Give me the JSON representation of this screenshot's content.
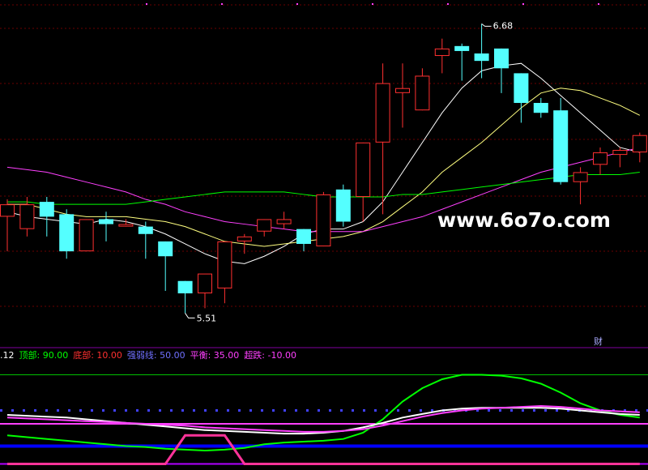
{
  "watermark": "www.6o7o.com",
  "finance_badge": "财",
  "indicator_header": [
    {
      "text": ".12",
      "color": "#ffffff"
    },
    {
      "text": "顶部: 90.00",
      "color": "#00ff00"
    },
    {
      "text": "底部: 10.00",
      "color": "#ff3030"
    },
    {
      "text": "强弱线: 50.00",
      "color": "#7070ff"
    },
    {
      "text": "平衡: 35.00",
      "color": "#ff40ff"
    },
    {
      "text": "超跌: -10.00",
      "color": "#ff40ff"
    }
  ],
  "chart_data": [
    {
      "type": "candlestick",
      "ylim": [
        5.4,
        6.75
      ],
      "price_labels": {
        "high": "6.68",
        "low": "5.51"
      },
      "candles": [
        {
          "o": 5.9,
          "h": 5.97,
          "l": 5.76,
          "c": 5.95
        },
        {
          "o": 5.85,
          "h": 5.98,
          "l": 5.82,
          "c": 5.95
        },
        {
          "o": 5.96,
          "h": 5.98,
          "l": 5.82,
          "c": 5.9
        },
        {
          "o": 5.91,
          "h": 5.93,
          "l": 5.73,
          "c": 5.76
        },
        {
          "o": 5.76,
          "h": 5.89,
          "l": 5.76,
          "c": 5.89
        },
        {
          "o": 5.89,
          "h": 5.92,
          "l": 5.8,
          "c": 5.87
        },
        {
          "o": 5.86,
          "h": 5.89,
          "l": 5.86,
          "c": 5.87
        },
        {
          "o": 5.86,
          "h": 5.88,
          "l": 5.73,
          "c": 5.83
        },
        {
          "o": 5.8,
          "h": 5.8,
          "l": 5.6,
          "c": 5.74
        },
        {
          "o": 5.64,
          "h": 5.64,
          "l": 5.51,
          "c": 5.59
        },
        {
          "o": 5.59,
          "h": 5.66,
          "l": 5.53,
          "c": 5.67
        },
        {
          "o": 5.61,
          "h": 5.8,
          "l": 5.55,
          "c": 5.8
        },
        {
          "o": 5.8,
          "h": 5.83,
          "l": 5.75,
          "c": 5.82
        },
        {
          "o": 5.84,
          "h": 5.89,
          "l": 5.82,
          "c": 5.89
        },
        {
          "o": 5.87,
          "h": 5.92,
          "l": 5.85,
          "c": 5.89
        },
        {
          "o": 5.85,
          "h": 5.85,
          "l": 5.76,
          "c": 5.79
        },
        {
          "o": 5.78,
          "h": 6.0,
          "l": 5.78,
          "c": 5.99
        },
        {
          "o": 6.01,
          "h": 6.03,
          "l": 5.86,
          "c": 5.88
        },
        {
          "o": 5.98,
          "h": 6.2,
          "l": 5.88,
          "c": 6.2
        },
        {
          "o": 6.2,
          "h": 6.52,
          "l": 5.91,
          "c": 6.44
        },
        {
          "o": 6.4,
          "h": 6.52,
          "l": 6.26,
          "c": 6.42
        },
        {
          "o": 6.33,
          "h": 6.5,
          "l": 6.33,
          "c": 6.47
        },
        {
          "o": 6.55,
          "h": 6.62,
          "l": 6.48,
          "c": 6.58
        },
        {
          "o": 6.59,
          "h": 6.6,
          "l": 6.45,
          "c": 6.57
        },
        {
          "o": 6.56,
          "h": 6.68,
          "l": 6.46,
          "c": 6.53
        },
        {
          "o": 6.58,
          "h": 6.58,
          "l": 6.4,
          "c": 6.5
        },
        {
          "o": 6.48,
          "h": 6.48,
          "l": 6.28,
          "c": 6.36
        },
        {
          "o": 6.36,
          "h": 6.38,
          "l": 6.3,
          "c": 6.32
        },
        {
          "o": 6.33,
          "h": 6.38,
          "l": 6.03,
          "c": 6.04
        },
        {
          "o": 6.04,
          "h": 6.1,
          "l": 5.95,
          "c": 6.08
        },
        {
          "o": 6.11,
          "h": 6.18,
          "l": 6.07,
          "c": 6.16
        },
        {
          "o": 6.15,
          "h": 6.18,
          "l": 6.1,
          "c": 6.17
        },
        {
          "o": 6.16,
          "h": 6.24,
          "l": 6.12,
          "c": 6.23
        }
      ],
      "ma_lines": [
        {
          "name": "MA5",
          "color": "#ffffff",
          "values": [
            5.92,
            5.9,
            5.89,
            5.88,
            5.87,
            5.89,
            5.88,
            5.86,
            5.83,
            5.79,
            5.75,
            5.72,
            5.71,
            5.74,
            5.78,
            5.83,
            5.85,
            5.85,
            5.88,
            5.96,
            6.08,
            6.2,
            6.32,
            6.42,
            6.49,
            6.51,
            6.52,
            6.46,
            6.39,
            6.32,
            6.25,
            6.18,
            6.16
          ]
        },
        {
          "name": "MA10",
          "color": "#ffff80",
          "values": [
            5.95,
            5.95,
            5.93,
            5.91,
            5.9,
            5.9,
            5.9,
            5.89,
            5.88,
            5.86,
            5.83,
            5.8,
            5.79,
            5.78,
            5.79,
            5.8,
            5.81,
            5.82,
            5.84,
            5.88,
            5.94,
            6.0,
            6.08,
            6.14,
            6.2,
            6.27,
            6.34,
            6.4,
            6.42,
            6.41,
            6.38,
            6.35,
            6.31
          ]
        },
        {
          "name": "MA20",
          "color": "#ff40ff",
          "values": [
            6.1,
            6.09,
            6.08,
            6.06,
            6.04,
            6.02,
            6.0,
            5.97,
            5.95,
            5.92,
            5.9,
            5.88,
            5.87,
            5.86,
            5.85,
            5.84,
            5.84,
            5.84,
            5.84,
            5.86,
            5.88,
            5.9,
            5.93,
            5.96,
            5.99,
            6.02,
            6.05,
            6.08,
            6.1,
            6.12,
            6.14,
            6.16,
            6.18
          ]
        },
        {
          "name": "MA60",
          "color": "#00ff00",
          "values": [
            5.96,
            5.96,
            5.95,
            5.95,
            5.95,
            5.95,
            5.95,
            5.96,
            5.97,
            5.98,
            5.99,
            6.0,
            6.0,
            6.0,
            6.0,
            5.99,
            5.98,
            5.98,
            5.98,
            5.98,
            5.99,
            5.99,
            6.0,
            6.01,
            6.02,
            6.03,
            6.04,
            6.05,
            6.06,
            6.07,
            6.07,
            6.07,
            6.08
          ]
        }
      ],
      "up_color": "#ff3030",
      "down_color": "#54ffff"
    },
    {
      "type": "line",
      "ylim": [
        -15,
        105
      ],
      "reference_lines": [
        {
          "name": "顶部",
          "value": 90
        },
        {
          "name": "底部",
          "value": 10
        },
        {
          "name": "强弱线",
          "value": 50
        },
        {
          "name": "平衡",
          "value": 35
        },
        {
          "name": "超跌",
          "value": -10
        }
      ],
      "series": [
        {
          "color": "#00ff00",
          "values": [
            22,
            20,
            18,
            16,
            14,
            12,
            10,
            9,
            7,
            6,
            5,
            6,
            8,
            12,
            14,
            15,
            16,
            18,
            25,
            40,
            60,
            75,
            85,
            90,
            90,
            89,
            86,
            80,
            70,
            58,
            50,
            45,
            42
          ]
        },
        {
          "color": "#ffffff",
          "values": [
            45,
            44,
            43,
            42,
            40,
            38,
            36,
            34,
            32,
            30,
            28,
            27,
            26,
            25,
            24,
            24,
            25,
            27,
            31,
            36,
            42,
            46,
            50,
            52,
            53,
            53,
            53,
            53,
            52,
            50,
            48,
            46,
            45
          ]
        },
        {
          "color": "#ff40ff",
          "values": [
            42,
            41,
            40,
            39,
            38,
            37,
            36,
            35,
            34,
            33,
            31,
            30,
            29,
            28,
            27,
            26,
            26,
            27,
            29,
            33,
            38,
            43,
            47,
            50,
            52,
            53,
            54,
            55,
            54,
            52,
            50,
            49,
            48
          ]
        },
        {
          "color": "#ff3399",
          "values": [
            -10,
            -10,
            -10,
            -10,
            -10,
            -10,
            -10,
            -10,
            -10,
            22,
            22,
            22,
            -10,
            -10,
            -10,
            -10,
            -10,
            -10,
            -10,
            -10,
            -10,
            -10,
            -10,
            -10,
            -10,
            -10,
            -10,
            -10,
            -10,
            -10,
            -10,
            -10,
            -10
          ]
        }
      ]
    }
  ]
}
